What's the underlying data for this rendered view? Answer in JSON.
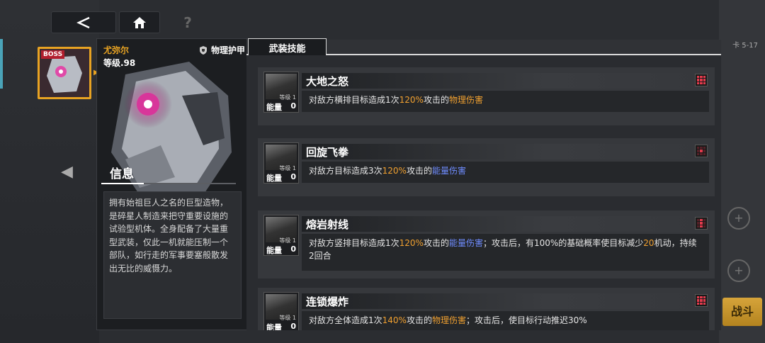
{
  "nav": {
    "back_icon": "chevron-left",
    "home_icon": "home",
    "help_icon": "?"
  },
  "unit": {
    "badge": "BOSS",
    "name": "尤弥尔",
    "level": "等级.98",
    "armor": "物理护甲",
    "info_tab": "信息",
    "description": "拥有始祖巨人之名的巨型造物，是碎星人制造来把守重要设施的试验型机体。全身配备了大量重型武装，仅此一机就能压制一个部队，如行走的军事要塞般散发出无比的威慑力。"
  },
  "skills_tab": "武装技能",
  "skills": [
    {
      "name": "大地之怒",
      "level_label": "等级",
      "level": "1",
      "energy_label": "能量",
      "energy": "0",
      "desc_parts": [
        {
          "t": "对敌方横排目标造成1次",
          "c": ""
        },
        {
          "t": "120%",
          "c": "orange"
        },
        {
          "t": "攻击的",
          "c": ""
        },
        {
          "t": "物理伤害",
          "c": "orange"
        }
      ],
      "grid_on": [
        0,
        1,
        2,
        3,
        4,
        5,
        6,
        7,
        8
      ]
    },
    {
      "name": "回旋飞拳",
      "level_label": "等级",
      "level": "1",
      "energy_label": "能量",
      "energy": "0",
      "desc_parts": [
        {
          "t": "对敌方目标造成3次",
          "c": ""
        },
        {
          "t": "120%",
          "c": "orange"
        },
        {
          "t": "攻击的",
          "c": ""
        },
        {
          "t": "能量伤害",
          "c": "blue"
        }
      ],
      "grid_on": [
        4
      ]
    },
    {
      "name": "熔岩射线",
      "level_label": "等级",
      "level": "1",
      "energy_label": "能量",
      "energy": "0",
      "desc_parts": [
        {
          "t": "对敌方竖排目标造成1次",
          "c": ""
        },
        {
          "t": "120%",
          "c": "orange"
        },
        {
          "t": "攻击的",
          "c": ""
        },
        {
          "t": "能量伤害",
          "c": "blue"
        },
        {
          "t": "；攻击后，有100%的基础概率使目标减少",
          "c": ""
        },
        {
          "t": "20",
          "c": "orange"
        },
        {
          "t": "机动，持续2回合",
          "c": ""
        }
      ],
      "grid_on": [
        1,
        4,
        7
      ]
    },
    {
      "name": "连锁爆炸",
      "level_label": "等级",
      "level": "1",
      "energy_label": "能量",
      "energy": "0",
      "desc_parts": [
        {
          "t": "对敌方全体造成1次",
          "c": ""
        },
        {
          "t": "140%",
          "c": "orange"
        },
        {
          "t": "攻击的",
          "c": ""
        },
        {
          "t": "物理伤害",
          "c": "orange"
        },
        {
          "t": "；攻击后，使目标行动推迟30%",
          "c": ""
        }
      ],
      "grid_on": [
        0,
        1,
        2,
        3,
        4,
        5,
        6,
        7,
        8
      ]
    }
  ],
  "right_panel": {
    "stage": "卡 5-17",
    "battle_button": "战斗"
  },
  "colors": {
    "accent_orange": "#f0a030",
    "energy_blue": "#6f8cff",
    "grid_red": "#e23a4c"
  }
}
